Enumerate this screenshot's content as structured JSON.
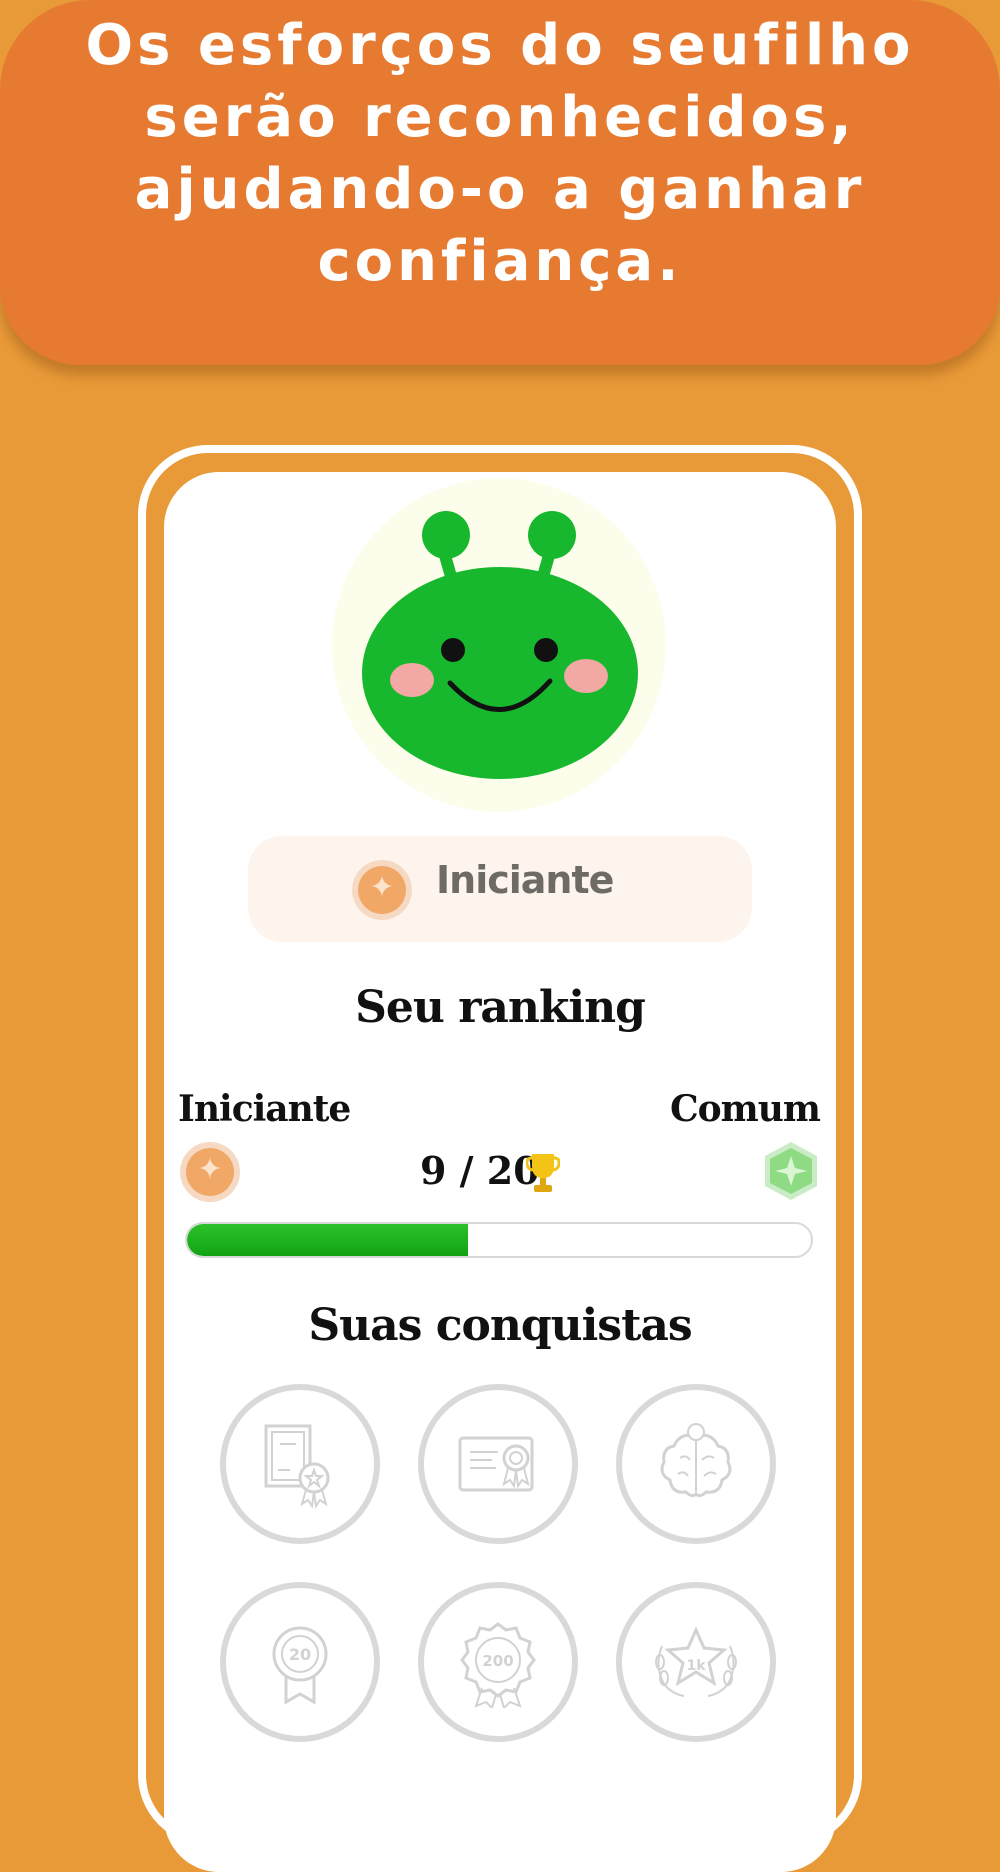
{
  "banner": {
    "headline": "Os esforços do seufilho serão reconhecidos, ajudando-o a ganhar confiança."
  },
  "profile": {
    "avatar_icon": "green-alien-mascot",
    "level_label": "Iniciante",
    "level_icon": "bronze-gem-coin-icon"
  },
  "ranking": {
    "title": "Seu ranking",
    "current_level": "Iniciante",
    "next_level": "Comum",
    "score": "9 / 20",
    "progress_fraction": 0.45,
    "trophy_icon": "trophy-icon",
    "next_level_icon": "green-hexagon-gem-icon"
  },
  "achievements": {
    "title": "Suas conquistas",
    "badges": [
      {
        "icon": "certificate-award-icon"
      },
      {
        "icon": "diploma-ribbon-icon"
      },
      {
        "icon": "brain-lightbulb-icon"
      },
      {
        "icon": "medal-20-icon",
        "text": "20"
      },
      {
        "icon": "rosette-200-icon",
        "text": "200"
      },
      {
        "icon": "laurel-star-1k-icon",
        "text": "1k"
      }
    ]
  },
  "colors": {
    "background": "#E99A38",
    "banner": "#E77A31",
    "progress": "#16A918",
    "badge_outline": "#D9D9D9"
  }
}
